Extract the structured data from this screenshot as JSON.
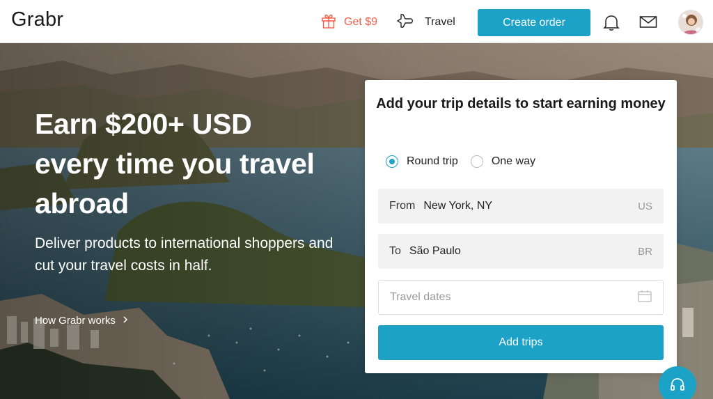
{
  "header": {
    "logo": "Grabr",
    "promo_label": "Get $9",
    "travel_label": "Travel",
    "create_order_label": "Create order",
    "promo_color": "#ee5f4a",
    "accent_color": "#1ba2c6"
  },
  "hero": {
    "headline": "Earn $200+ USD every time you travel abroad",
    "subline": "Deliver products to international shoppers and cut your travel costs in half.",
    "how_link": "How Grabr works"
  },
  "form": {
    "title": "Add your trip details to start earning money",
    "trip_types": [
      {
        "label": "Round trip",
        "selected": true
      },
      {
        "label": "One way",
        "selected": false
      }
    ],
    "from": {
      "label": "From",
      "value": "New York, NY",
      "country": "US"
    },
    "to": {
      "label": "To",
      "value": "São Paulo",
      "country": "BR"
    },
    "dates": {
      "placeholder": "Travel dates"
    },
    "submit_label": "Add trips"
  },
  "icons": {
    "gift": "gift-icon",
    "plane": "plane-icon",
    "bell": "bell-icon",
    "mail": "mail-icon",
    "calendar": "calendar-icon",
    "chevron": "chevron-right-icon",
    "support": "headset-icon"
  }
}
